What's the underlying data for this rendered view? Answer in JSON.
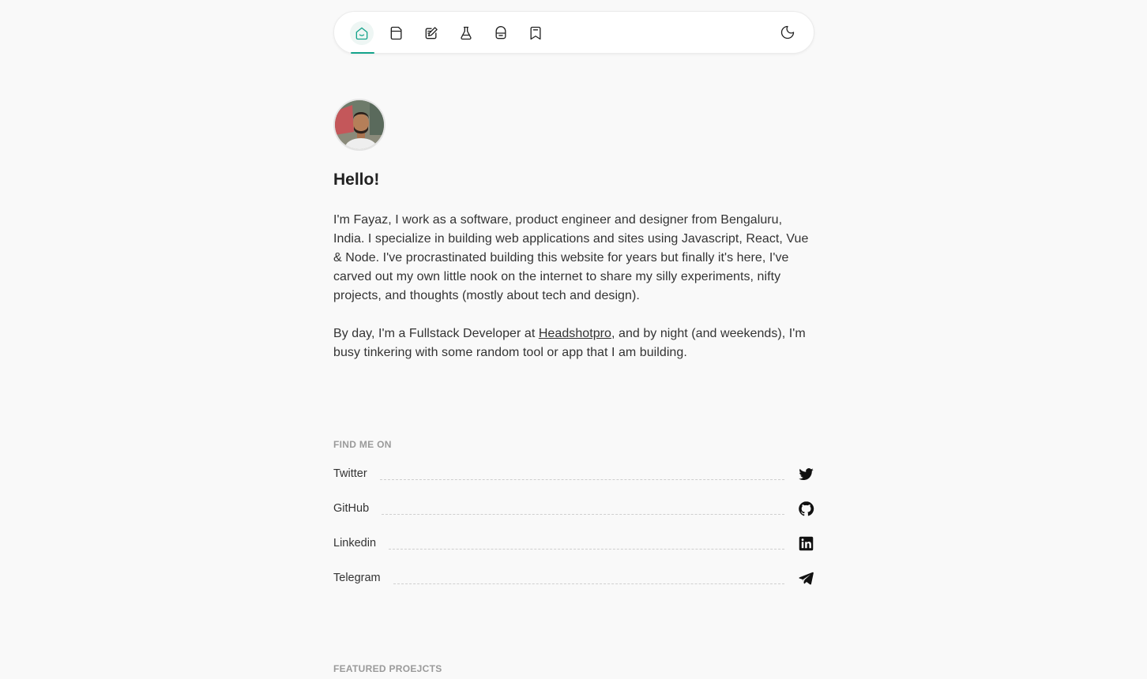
{
  "nav": {
    "items": [
      {
        "icon": "home-icon",
        "label": "Home",
        "active": true
      },
      {
        "icon": "notes-icon",
        "label": "Notes",
        "active": false
      },
      {
        "icon": "blog-edit-icon",
        "label": "Writing",
        "active": false
      },
      {
        "icon": "lab-flask-icon",
        "label": "Experiments",
        "active": false
      },
      {
        "icon": "projects-box-icon",
        "label": "Projects",
        "active": false
      },
      {
        "icon": "bookmark-icon",
        "label": "Bookmarks",
        "active": false
      }
    ],
    "theme_icon": "moon-icon",
    "accent": "#14a38b"
  },
  "intro": {
    "heading": "Hello!",
    "paragraph1": "I'm Fayaz, I work as a software, product engineer and designer from Bengaluru, India. I specialize in building web applications and sites using Javascript, React, Vue & Node. I've procrastinated building this website for years but finally it's here, I've carved out my own little nook on the internet to share my silly experiments, nifty projects, and thoughts (mostly about tech and design).",
    "paragraph2_before": "By day, I'm a Fullstack Developer at ",
    "paragraph2_link": "Headshotpro",
    "paragraph2_after": ", and by night (and weekends), I'm busy tinkering with some random tool or app that I am building."
  },
  "social": {
    "label": "FIND ME ON",
    "links": [
      {
        "name": "Twitter",
        "icon": "twitter-icon"
      },
      {
        "name": "GitHub",
        "icon": "github-icon"
      },
      {
        "name": "Linkedin",
        "icon": "linkedin-icon"
      },
      {
        "name": "Telegram",
        "icon": "telegram-icon"
      }
    ]
  },
  "projects": {
    "label": "FEATURED PROEJCTS"
  }
}
